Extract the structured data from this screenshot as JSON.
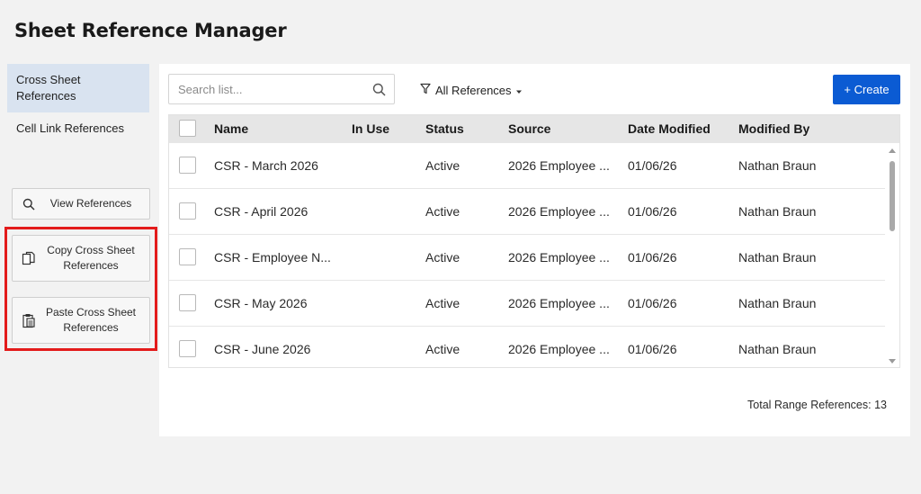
{
  "app": {
    "title": "Sheet Reference Manager"
  },
  "nav": {
    "items": [
      {
        "label": "Cross Sheet References",
        "active": true
      },
      {
        "label": "Cell Link References",
        "active": false
      }
    ]
  },
  "actions": {
    "view_label": "View References",
    "copy_label": "Copy Cross Sheet References",
    "paste_label": "Paste Cross Sheet References",
    "highlight_color": "#e31b1b"
  },
  "toolbar": {
    "search_placeholder": "Search list...",
    "filter_label": "All References",
    "create_label": "+ Create",
    "accent": "#0b5bd3"
  },
  "table": {
    "columns": [
      "Name",
      "In Use",
      "Status",
      "Source",
      "Date Modified",
      "Modified By"
    ],
    "rows": [
      {
        "name": "CSR - March 2026",
        "in_use": "",
        "status": "Active",
        "source": "2026 Employee ...",
        "date_modified": "01/06/26",
        "modified_by": "Nathan Braun"
      },
      {
        "name": "CSR - April 2026",
        "in_use": "",
        "status": "Active",
        "source": "2026 Employee ...",
        "date_modified": "01/06/26",
        "modified_by": "Nathan Braun"
      },
      {
        "name": "CSR - Employee N...",
        "in_use": "",
        "status": "Active",
        "source": "2026 Employee ...",
        "date_modified": "01/06/26",
        "modified_by": "Nathan Braun"
      },
      {
        "name": "CSR - May 2026",
        "in_use": "",
        "status": "Active",
        "source": "2026 Employee ...",
        "date_modified": "01/06/26",
        "modified_by": "Nathan Braun"
      },
      {
        "name": "CSR - June 2026",
        "in_use": "",
        "status": "Active",
        "source": "2026 Employee ...",
        "date_modified": "01/06/26",
        "modified_by": "Nathan Braun"
      }
    ]
  },
  "footer": {
    "total_label": "Total Range References: 13"
  }
}
